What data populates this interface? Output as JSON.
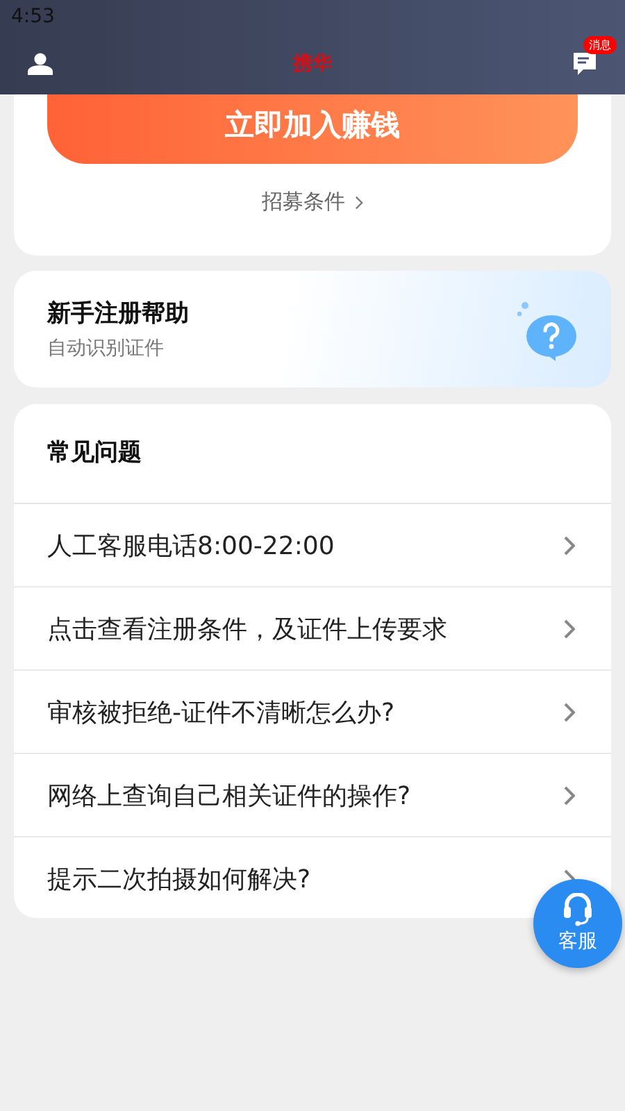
{
  "status_bar": {
    "time": "4:53"
  },
  "header": {
    "title": "携华",
    "badge": "消息"
  },
  "join_card": {
    "button": "立即加入赚钱",
    "link": "招募条件"
  },
  "help_card": {
    "title": "新手注册帮助",
    "subtitle": "自动识别证件"
  },
  "faq": {
    "title": "常见问题",
    "items": [
      {
        "text": "人工客服电话8:00-22:00"
      },
      {
        "text": "点击查看注册条件，及证件上传要求"
      },
      {
        "text": "审核被拒绝-证件不清晰怎么办?"
      },
      {
        "text": "网络上查询自己相关证件的操作?"
      },
      {
        "text": "提示二次拍摄如何解决?"
      }
    ]
  },
  "service_button": {
    "label": "客服"
  }
}
